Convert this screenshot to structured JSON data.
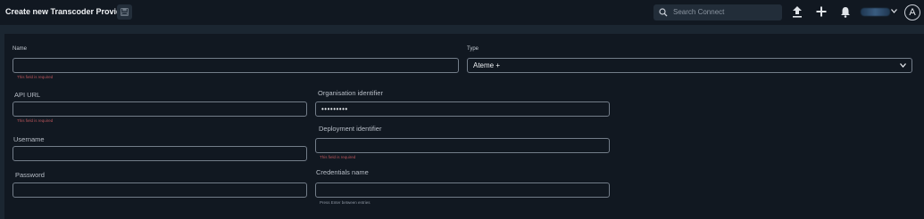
{
  "header": {
    "title": "Create new Transcoder Provider",
    "save_icon": "save-icon",
    "search_placeholder": "Search Connect",
    "upload_icon": "upload-icon",
    "add_icon": "plus-icon",
    "notifications_icon": "bell-icon",
    "user_menu_icon": "chevron-down-icon",
    "avatar_initial": "A"
  },
  "form": {
    "name": {
      "label": "Name",
      "value": "",
      "error": "This field is required"
    },
    "type": {
      "label": "Type",
      "value": "Ateme +"
    },
    "api_url": {
      "label": "API URL",
      "value": "",
      "error": "This field is required"
    },
    "organisation_identifier": {
      "label": "Organisation identifier",
      "value": "•••••••••"
    },
    "username": {
      "label": "Username",
      "value": ""
    },
    "deployment_identifier": {
      "label": "Deployment identifier",
      "value": "",
      "error": "This field is required"
    },
    "password": {
      "label": "Password",
      "value": ""
    },
    "credentials_name": {
      "label": "Credentials name",
      "value": "",
      "hint": "Press Enter between entries"
    }
  },
  "colors": {
    "background": "#1b2631",
    "panel": "#111821",
    "error": "#b9545a"
  }
}
